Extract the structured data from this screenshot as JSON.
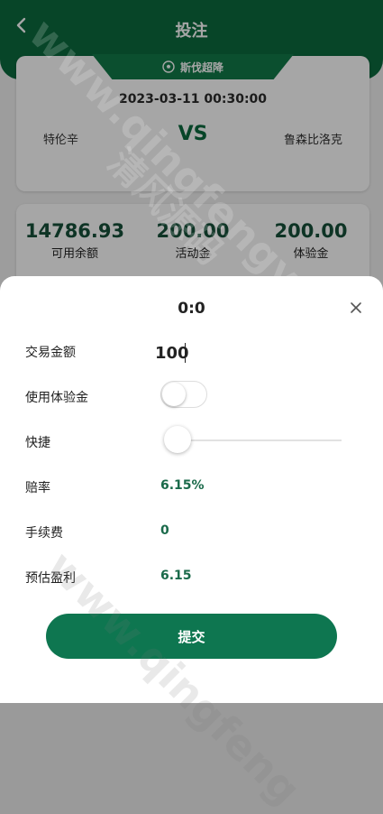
{
  "header": {
    "title": "投注"
  },
  "match": {
    "league": "斯伐超降",
    "time": "2023-03-11 00:30:00",
    "home_team": "特伦辛",
    "vs_label": "VS",
    "away_team": "鲁森比洛克"
  },
  "balances": [
    {
      "value": "14786.93",
      "label": "可用余额"
    },
    {
      "value": "200.00",
      "label": "活动金"
    },
    {
      "value": "200.00",
      "label": "体验金"
    }
  ],
  "sheet": {
    "title": "0:0",
    "amount_label": "交易金额",
    "amount_value": "100",
    "use_trial_label": "使用体验金",
    "use_trial_enabled": false,
    "quick_label": "快捷",
    "quick_slider_fraction": 0,
    "odds_label": "赔率",
    "odds_value": "6.15%",
    "fee_label": "手续费",
    "fee_value": "0",
    "profit_label": "预估盈利",
    "profit_value": "6.15",
    "submit_label": "提交"
  },
  "watermarks": [
    "www.qingfengyun.com",
    "清风源码",
    "www.qingfeng"
  ]
}
